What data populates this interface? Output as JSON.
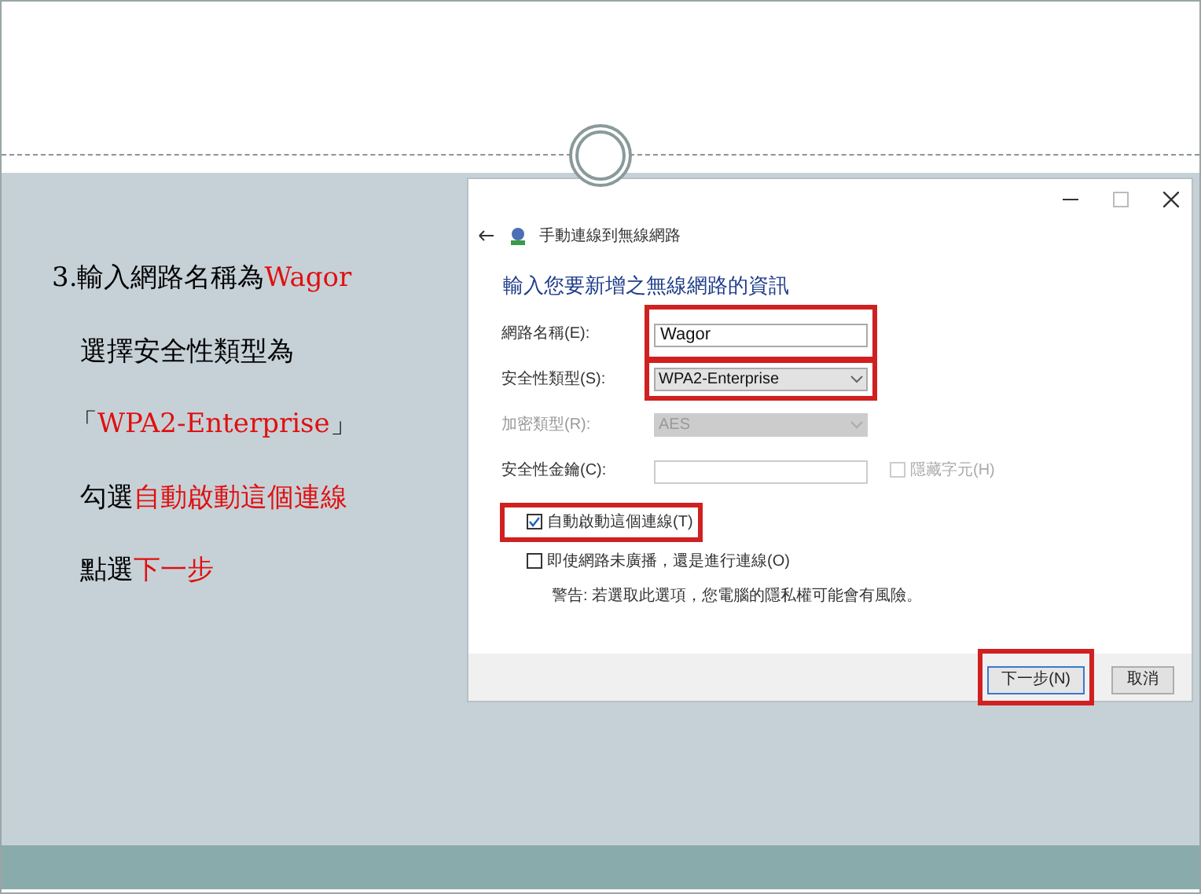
{
  "steps": [
    {
      "segments": [
        {
          "text": "3.輸入網路名稱為",
          "highlight": false
        },
        {
          "text": "Wagor",
          "highlight": true
        }
      ]
    },
    {
      "segments": [
        {
          "text": "選擇安全性類型為",
          "highlight": false
        }
      ]
    },
    {
      "segments": [
        {
          "text": "「",
          "highlight": false
        },
        {
          "text": "WPA2-Enterprise",
          "highlight": true
        },
        {
          "text": "」",
          "highlight": false
        }
      ]
    },
    {
      "segments": [
        {
          "text": "勾選",
          "highlight": false
        },
        {
          "text": "自動啟動這個連線",
          "highlight": true
        }
      ]
    },
    {
      "segments": [
        {
          "text": "點選",
          "highlight": false
        },
        {
          "text": "下一步",
          "highlight": true
        }
      ]
    }
  ],
  "dialog": {
    "title": "手動連線到無線網路",
    "heading": "輸入您要新增之無線網路的資訊",
    "fields": [
      {
        "kind": "text",
        "label": "網路名稱(E):",
        "value": "Wagor",
        "highlighted": true,
        "disabled": false
      },
      {
        "kind": "select",
        "label": "安全性類型(S):",
        "value": "WPA2-Enterprise",
        "highlighted": true,
        "disabled": false
      },
      {
        "kind": "select",
        "label": "加密類型(R):",
        "value": "AES",
        "highlighted": false,
        "disabled": true
      },
      {
        "kind": "password",
        "label": "安全性金鑰(C):",
        "highlighted": false,
        "disabled": false,
        "option": {
          "label": "隱藏字元(H)",
          "checked": false,
          "disabled": true
        }
      }
    ],
    "checkboxes": [
      {
        "label": "自動啟動這個連線(T)",
        "checked": true,
        "highlighted": true
      },
      {
        "label": "即使網路未廣播，還是進行連線(O)",
        "checked": false,
        "highlighted": false
      }
    ],
    "warning": "警告: 若選取此選項，您電腦的隱私權可能會有風險。",
    "buttons": [
      {
        "label": "下一步(N)",
        "highlighted": true,
        "default": true
      },
      {
        "label": "取消",
        "highlighted": false,
        "default": false
      }
    ]
  }
}
